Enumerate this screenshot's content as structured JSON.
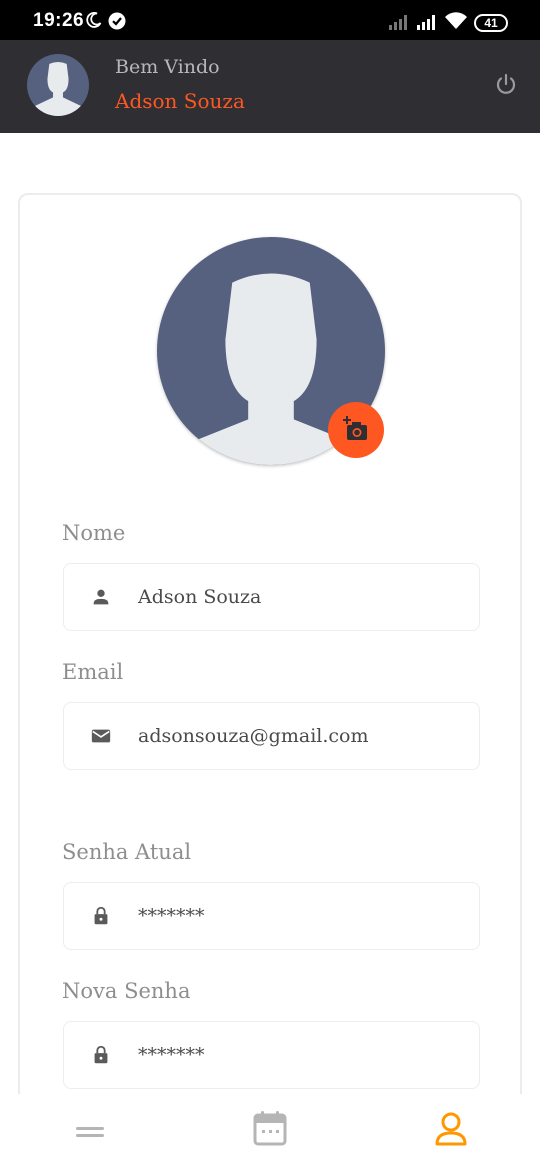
{
  "status_bar": {
    "time": "19:26",
    "battery": "41"
  },
  "header": {
    "welcome": "Bem Vindo",
    "user_name": "Adson Souza"
  },
  "form": {
    "name_label": "Nome",
    "name_value": "Adson Souza",
    "email_label": "Email",
    "email_value": "adsonsouza@gmail.com",
    "current_password_label": "Senha Atual",
    "current_password_value": "*******",
    "new_password_label": "Nova Senha",
    "new_password_value": "*******"
  },
  "colors": {
    "accent": "#ff5722",
    "header_bg": "#2e2e33",
    "avatar_bg": "#56617f",
    "nav_active": "#ff9800"
  },
  "icons": {
    "moon": "moon-icon",
    "dnd": "check-circle-icon",
    "signal": "signal-icon",
    "wifi": "wifi-icon",
    "battery": "battery-icon",
    "power": "power-icon",
    "camera": "add-camera-icon",
    "person": "person-icon",
    "email": "email-icon",
    "lock": "lock-icon",
    "menu": "menu-icon",
    "calendar": "calendar-icon",
    "profile": "profile-icon"
  }
}
